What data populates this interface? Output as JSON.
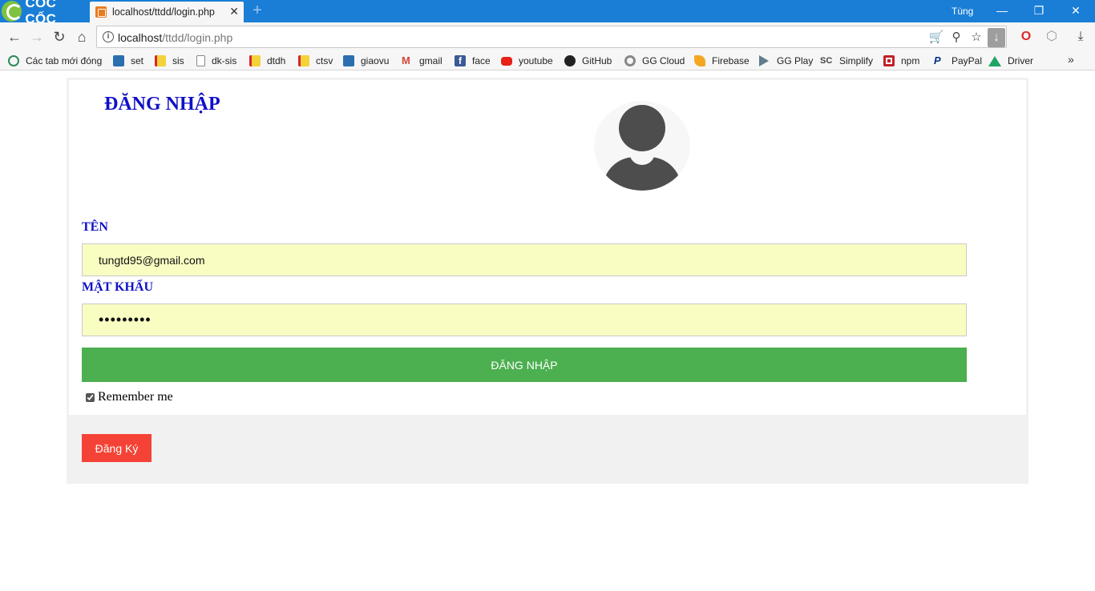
{
  "browser": {
    "brand": "CỐC CỐC",
    "tab": {
      "title": "localhost/ttdd/login.php",
      "close": "✕"
    },
    "new_tab": "+",
    "user": "Tùng",
    "window_controls": {
      "minimize": "—",
      "restore": "❐",
      "close": "✕"
    },
    "address": {
      "host": "localhost",
      "path": "/ttdd/login.php"
    },
    "icons": [
      "back-icon",
      "forward-icon",
      "reload-icon",
      "home-icon",
      "info-icon",
      "cart-icon",
      "key-icon",
      "star-icon",
      "download-icon",
      "opera-icon",
      "extension-icon",
      "downloads-icon"
    ],
    "bookmarks": [
      {
        "label": "Các tab mới đóng",
        "icon": "history-icon",
        "color": "#2e8b57"
      },
      {
        "label": "set",
        "icon": "site-icon",
        "color": "#2b6fb0"
      },
      {
        "label": "sis",
        "icon": "site-icon",
        "color": "#d7262b"
      },
      {
        "label": "dk-sis",
        "icon": "page-icon",
        "color": "#888888"
      },
      {
        "label": "dtdh",
        "icon": "site-icon",
        "color": "#d7262b"
      },
      {
        "label": "ctsv",
        "icon": "site-icon",
        "color": "#d7262b"
      },
      {
        "label": "giaovu",
        "icon": "site-icon",
        "color": "#2b6fb0"
      },
      {
        "label": "gmail",
        "icon": "gmail-icon",
        "color": "#d44638"
      },
      {
        "label": "face",
        "icon": "facebook-icon",
        "color": "#3b5998"
      },
      {
        "label": "youtube",
        "icon": "youtube-icon",
        "color": "#e62117"
      },
      {
        "label": "GitHub",
        "icon": "github-icon",
        "color": "#222222"
      },
      {
        "label": "GG Cloud",
        "icon": "gear-icon",
        "color": "#888888"
      },
      {
        "label": "Firebase",
        "icon": "firebase-icon",
        "color": "#f5a623"
      },
      {
        "label": "GG Play",
        "icon": "play-icon",
        "color": "#607d8b"
      },
      {
        "label": "Simplify",
        "icon": "simplify-icon",
        "color": "#444444"
      },
      {
        "label": "npm",
        "icon": "npm-icon",
        "color": "#c12127"
      },
      {
        "label": "PayPal",
        "icon": "paypal-icon",
        "color": "#003087"
      },
      {
        "label": "Driver",
        "icon": "drive-icon",
        "color": "#1fa463"
      }
    ],
    "more": "»"
  },
  "login": {
    "heading": "ĐĂNG NHẬP",
    "username_label": "TÊN",
    "username_value": "tungtd95@gmail.com",
    "password_label": "MẬT KHẨU",
    "password_value": "•••••••••",
    "submit_label": "ĐĂNG NHẬP",
    "remember_label": "Remember me",
    "remember_checked": true,
    "register_label": "Đăng Ký"
  },
  "colors": {
    "heading": "#1010c8",
    "input_bg": "#fafdc2",
    "submit": "#4caf50",
    "register": "#f44336",
    "titlebar": "#1a7ed6"
  }
}
